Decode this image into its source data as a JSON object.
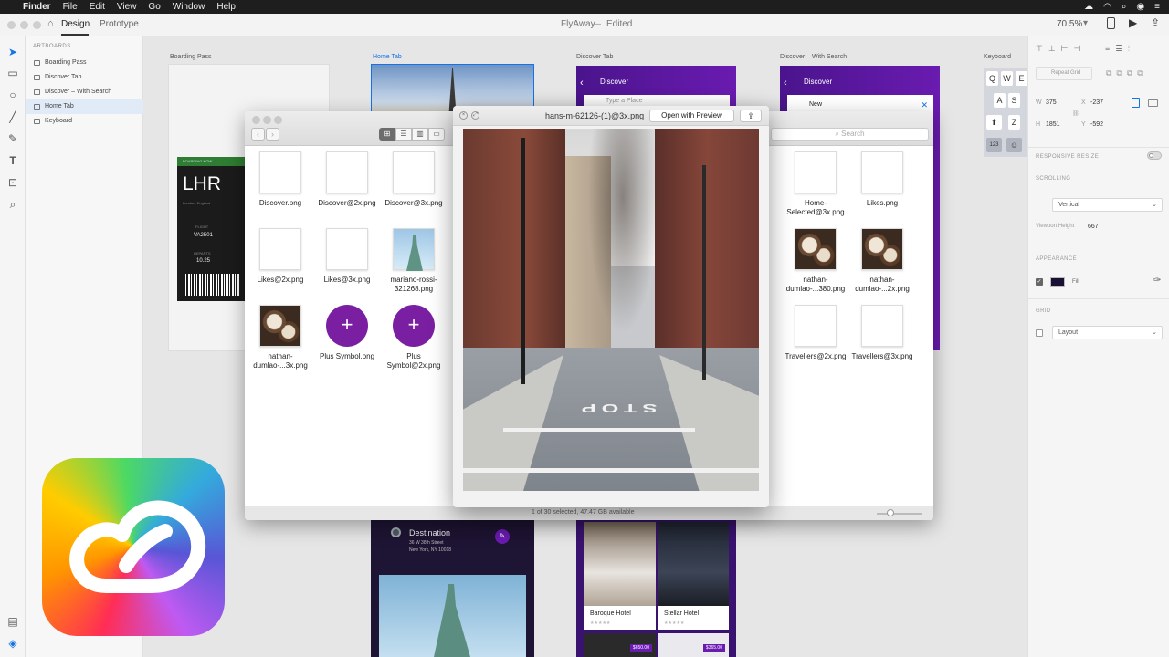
{
  "menubar": {
    "apple": "",
    "app": "Finder",
    "items": [
      "File",
      "Edit",
      "View",
      "Go",
      "Window",
      "Help"
    ]
  },
  "xd": {
    "tabs": [
      "Design",
      "Prototype"
    ],
    "doc_title": "FlyAway",
    "doc_status": "Edited",
    "zoom": "70.5%"
  },
  "layers": {
    "header": "ARTBOARDS",
    "items": [
      "Boarding Pass",
      "Discover Tab",
      "Discover – With Search",
      "Home Tab",
      "Keyboard"
    ]
  },
  "artboards": {
    "boarding_label": "Boarding Pass",
    "home_label": "Home Tab",
    "discover_label": "Discover Tab",
    "discover_search_label": "Discover – With Search",
    "keyboard_label": "Keyboard",
    "boarding": {
      "banner": "BOARDING NOW",
      "code": "LHR",
      "city": "London, England",
      "flight_label": "FLIGHT",
      "flight": "VA2501",
      "departs_label": "DEPARTS",
      "departs": "10.25"
    },
    "discover_title": "Discover",
    "discover_placeholder": "Type a Place",
    "discover_search_value": "New",
    "destination": {
      "title": "Destination",
      "line1": "36 W 38th Street",
      "line2": "New York, NY 10018"
    },
    "hotels": [
      {
        "name": "Baroque Hotel",
        "stars": "★★★★★"
      },
      {
        "name": "Stellar Hotel",
        "stars": "★★★★★"
      }
    ],
    "prices": [
      "$650.00",
      "$365.00"
    ],
    "keyboard_keys": [
      "Q",
      "W",
      "E",
      "A",
      "S",
      "Z",
      "123"
    ]
  },
  "right_panel": {
    "repeat_grid": "Repeat Grid",
    "w_label": "W",
    "w": "375",
    "x_label": "X",
    "x": "-237",
    "h_label": "H",
    "h": "1851",
    "y_label": "Y",
    "y": "-592",
    "responsive_resize": "RESPONSIVE RESIZE",
    "scrolling": "SCROLLING",
    "scrolling_value": "Vertical",
    "viewport_height_label": "Viewport Height",
    "viewport_height": "667",
    "appearance": "APPEARANCE",
    "fill_label": "Fill",
    "fill_color": "#1a1033",
    "grid": "GRID",
    "grid_value": "Layout"
  },
  "finder": {
    "search_placeholder": "Search",
    "status": "1 of 30 selected, 47.47 GB available",
    "files_left": [
      {
        "name": "Discover.png",
        "kind": "blank"
      },
      {
        "name": "Discover@2x.png",
        "kind": "blank"
      },
      {
        "name": "Discover@3x.png",
        "kind": "blank"
      },
      {
        "name": "Likes@2x.png",
        "kind": "blank"
      },
      {
        "name": "Likes@3x.png",
        "kind": "blank"
      },
      {
        "name": "mariano-rossi-321268.png",
        "kind": "statue"
      },
      {
        "name": "nathan-dumlao-...3x.png",
        "kind": "coffee"
      },
      {
        "name": "Plus Symbol.png",
        "kind": "plus"
      },
      {
        "name": "Plus Symbol@2x.png",
        "kind": "plus"
      }
    ],
    "files_right": [
      {
        "name": "Home-Selected@3x.png",
        "kind": "blank"
      },
      {
        "name": "Likes.png",
        "kind": "blank"
      },
      {
        "name": "nathan-dumlao-...380.png",
        "kind": "coffee"
      },
      {
        "name": "nathan-dumlao-...2x.png",
        "kind": "coffee"
      },
      {
        "name": "Travellers@2x.png",
        "kind": "blank"
      },
      {
        "name": "Travellers@3x.png",
        "kind": "blank"
      }
    ],
    "right_partial_labels": [
      "...ng",
      "...g"
    ]
  },
  "preview": {
    "filename": "hans-m-62126-(1)@3x.png",
    "open_button": "Open with Preview",
    "road_text": "STOP"
  },
  "colors": {
    "purple": "#6a1bb0",
    "accent_blue": "#1473e6"
  }
}
